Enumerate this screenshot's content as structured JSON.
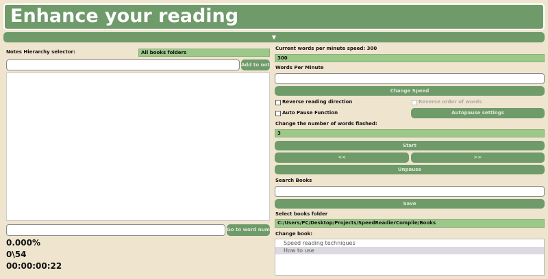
{
  "header": {
    "title": "Enhance your reading",
    "collapse_icon": "▼"
  },
  "left": {
    "notes_label": "Notes Hierarchy selector:",
    "folder_select": "All books folders",
    "note_input": "",
    "add_notes": "Add to notes",
    "text_area": "",
    "word_input": "",
    "go_word": "Go to word number",
    "percent": "0.000%",
    "word_count": "0\\54",
    "time": "00:00:00:22"
  },
  "right": {
    "current_wpm": "Current words per minute speed: 300",
    "wpm_select": "300",
    "wpm_label": "Words Per Minute",
    "wpm_input": "",
    "change_speed": "Change Speed",
    "reverse_direction": "Reverse reading direction",
    "reverse_order": "Reverse order of words",
    "auto_pause": "Auto Pause Function",
    "autopause_settings": "Autopause settings",
    "words_flashed_label": "Change the number of words flashed:",
    "words_flashed": "3",
    "start": "Start",
    "prev": "<<",
    "next": ">>",
    "unpause": "Unpause",
    "search_label": "Search Books",
    "search_input": "",
    "save": "Save",
    "folder_label": "Select books folder",
    "folder_path": "C:/Users/PC/Desktop/Projects/SpeedReadierCompile/Books",
    "change_book_label": "Change book:",
    "books": [
      "Speed reading techniques",
      "How to use"
    ],
    "selected_book": "How to use"
  },
  "colors": {
    "background": "#efe5cf",
    "accent": "#6f9a6a",
    "select": "#9cc88a"
  }
}
